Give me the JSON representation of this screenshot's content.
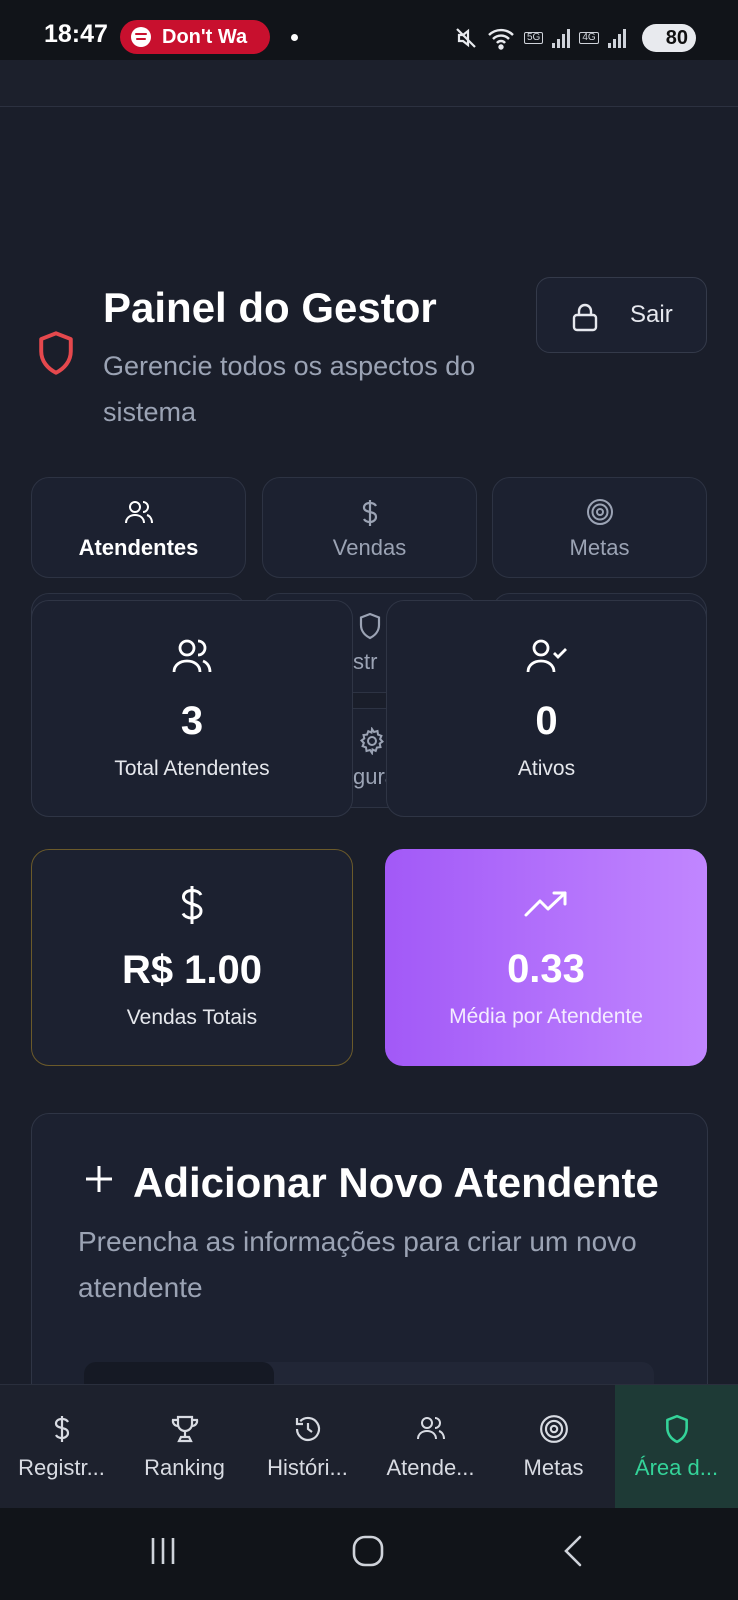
{
  "status_bar": {
    "time": "18:47",
    "media_text": "Don't Wa",
    "signal_5g": "5G",
    "signal_4g": "4G",
    "battery": "80"
  },
  "header": {
    "title": "Painel do Gestor",
    "subtitle": "Gerencie todos os aspectos do sistema",
    "logout_label": "Sair"
  },
  "tabs": [
    {
      "label": "Atendentes",
      "icon": "users-icon",
      "active": true
    },
    {
      "label": "Vendas",
      "icon": "dollar-icon",
      "active": false
    },
    {
      "label": "Metas",
      "icon": "target-icon",
      "active": false
    },
    {
      "label": "str",
      "icon": "shield-icon",
      "active": false
    },
    {
      "label": "gura",
      "icon": "gear-icon",
      "active": false
    }
  ],
  "stats": [
    {
      "value": "3",
      "label": "Total Atendentes",
      "icon": "users-icon"
    },
    {
      "value": "0",
      "label": "Ativos",
      "icon": "user-check-icon"
    },
    {
      "value": "R$ 1.00",
      "label": "Vendas Totais",
      "icon": "dollar-icon"
    },
    {
      "value": "0.33",
      "label": "Média por Atendente",
      "icon": "trending-up-icon"
    }
  ],
  "add_section": {
    "title": "Adicionar Novo Atendente",
    "description": "Preencha as informações para criar um novo atendente"
  },
  "bottom_nav": [
    {
      "label": "Registr...",
      "icon": "dollar-icon"
    },
    {
      "label": "Ranking",
      "icon": "trophy-icon"
    },
    {
      "label": "Históri...",
      "icon": "history-icon"
    },
    {
      "label": "Atende...",
      "icon": "users-icon"
    },
    {
      "label": "Metas",
      "icon": "target-icon"
    },
    {
      "label": "Área d...",
      "icon": "shield-icon",
      "active": true
    }
  ],
  "colors": {
    "background": "#1a1e2a",
    "card": "#1c2130",
    "danger": "#e5484d",
    "accent_green": "#34d399",
    "purple_start": "#a259f7",
    "purple_end": "#c186ff"
  }
}
